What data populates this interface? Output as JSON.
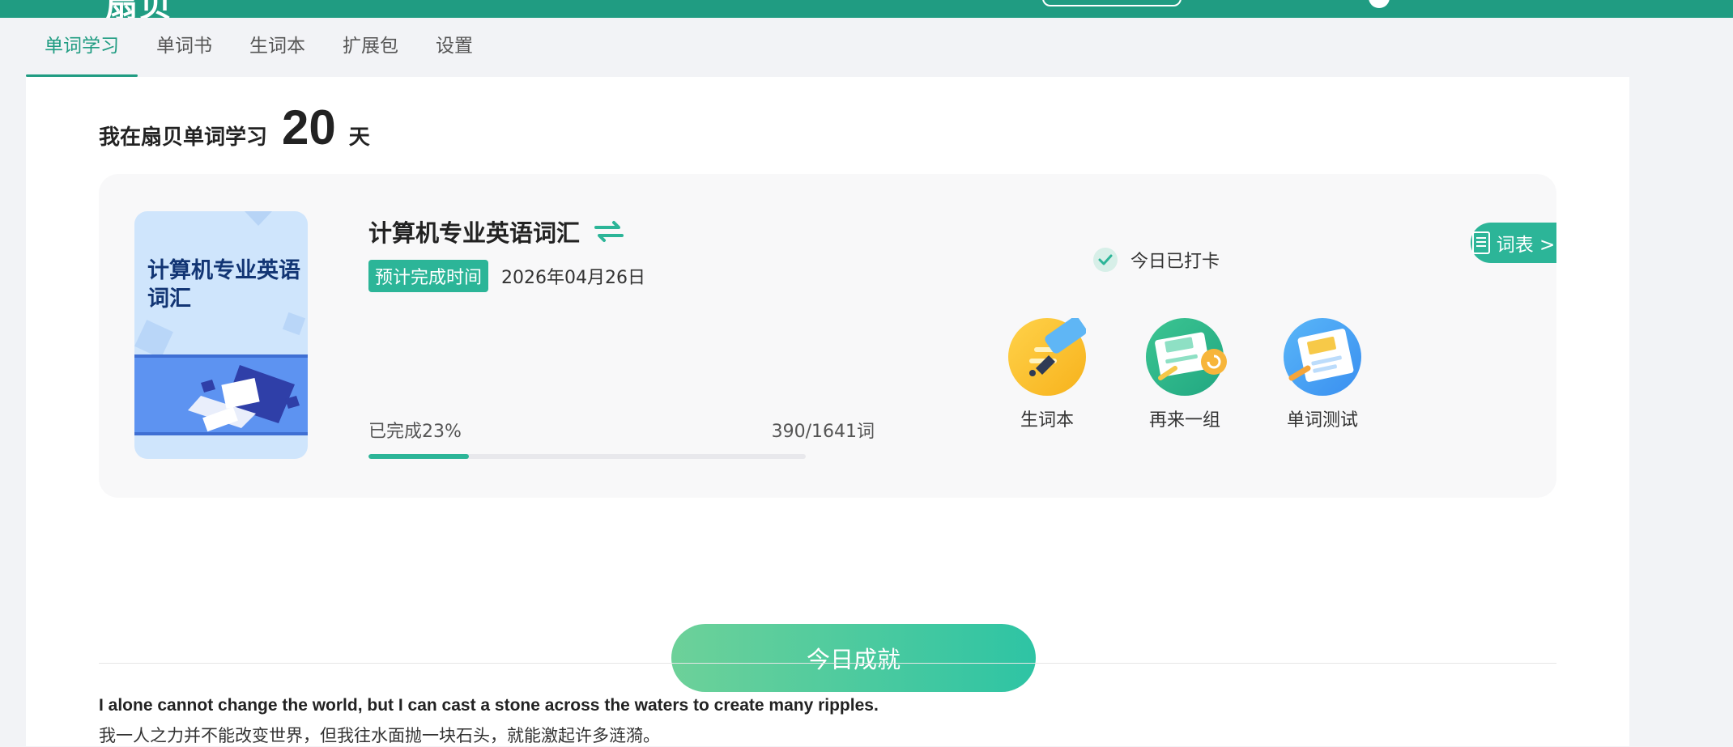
{
  "header": {
    "logo_text": "扇贝"
  },
  "tabs": [
    {
      "label": "单词学习",
      "active": true
    },
    {
      "label": "单词书",
      "active": false
    },
    {
      "label": "生词本",
      "active": false
    },
    {
      "label": "扩展包",
      "active": false
    },
    {
      "label": "设置",
      "active": false
    }
  ],
  "streak": {
    "prefix": "我在扇贝单词学习",
    "days": "20",
    "suffix": "天"
  },
  "book": {
    "cover_title": "计算机专业英语词汇",
    "title": "计算机专业英语词汇",
    "eta_label": "预计完成时间",
    "eta_date": "2026年04月26日",
    "progress_text": "已完成23%",
    "progress_fraction": 0.23,
    "count_text": "390/1641词"
  },
  "checkin": {
    "text": "今日已打卡"
  },
  "wordlist": {
    "label": "词表 >"
  },
  "actions": [
    {
      "label": "生词本",
      "icon": "notebook-pen-icon"
    },
    {
      "label": "再来一组",
      "icon": "refresh-group-icon"
    },
    {
      "label": "单词测试",
      "icon": "word-test-icon"
    }
  ],
  "achievement": {
    "label": "今日成就"
  },
  "quote": {
    "en": "I alone cannot change the world, but I can cast a stone across the waters to create many ripples.",
    "zh": "我一人之力并不能改变世界，但我往水面抛一块石头，就能激起许多涟漪。"
  },
  "colors": {
    "brand": "#209c82",
    "accent": "#2cb598"
  }
}
